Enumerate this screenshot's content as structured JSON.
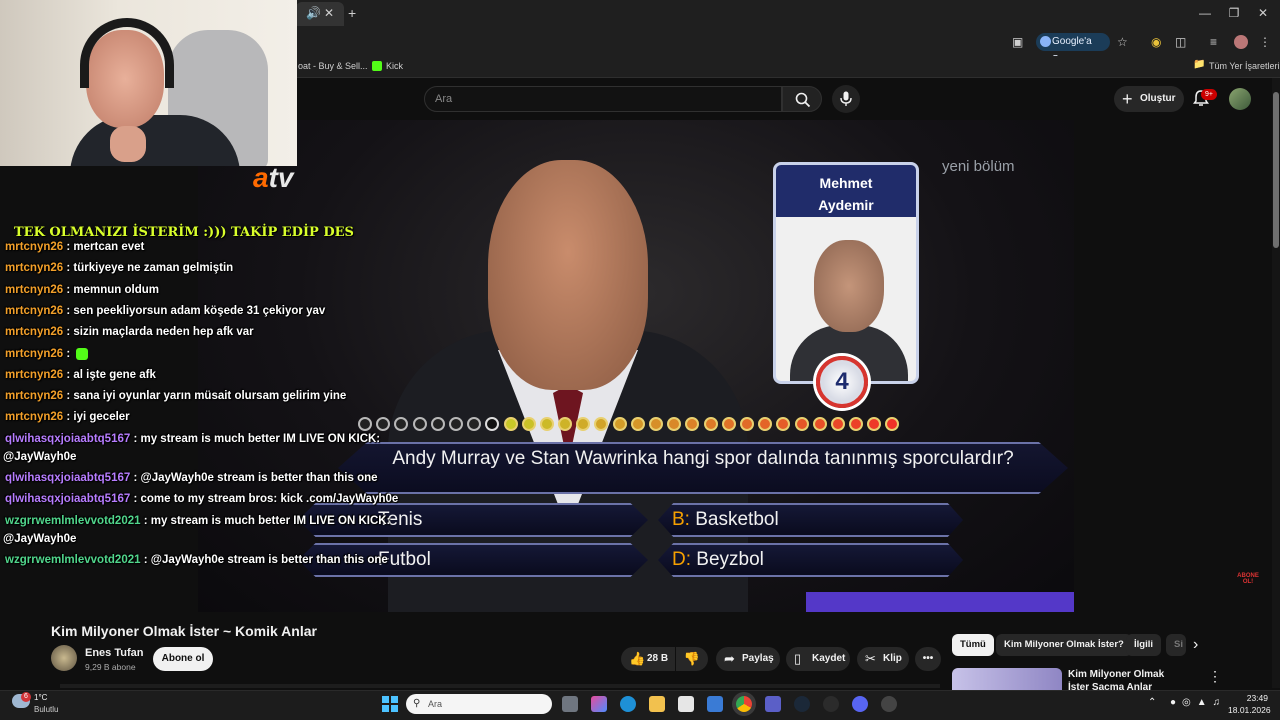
{
  "browser": {
    "tab_fragment": "",
    "google_button": "Google'a Sor",
    "bookmark_1": "oat - Buy & Sell...",
    "bookmark_2": "Kick",
    "all_bookmarks": "Tüm Yer İşaretleri"
  },
  "youtube": {
    "search_placeholder": "Ara",
    "create_label": "Oluştur",
    "notifications_badge": "9+"
  },
  "video_overlay": {
    "channel_logo": "atv",
    "corner_text": "yeni bölüm",
    "caller_name_line1": "Mehmet",
    "caller_name_line2": "Aydemir",
    "lifeline_number": "4",
    "question": "Andy Murray ve Stan Wawrinka hangi spor dalında tanınmış sporculardır?",
    "answers": [
      {
        "letter": "",
        "text": "Tenis"
      },
      {
        "letter": "B:",
        "text": "Basketbol"
      },
      {
        "letter": "",
        "text": "Futbol"
      },
      {
        "letter": "D:",
        "text": "Beyzbol"
      }
    ],
    "subscribe_badge": "ABONE OL!"
  },
  "chat": {
    "banner": "TEK OLMANIZI İSTERİM :))) TAKİP EDİP DES",
    "messages": [
      {
        "user": "mrtcnyn26",
        "text": ": mertcan evet"
      },
      {
        "user": "mrtcnyn26",
        "text": ": türkiyeye ne zaman gelmiştin"
      },
      {
        "user": "mrtcnyn26",
        "text": ": memnun oldum"
      },
      {
        "user": "mrtcnyn26",
        "text": ": sen peekliyorsun adam köşede 31 çekiyor yav"
      },
      {
        "user": "mrtcnyn26",
        "text": ": sizin maçlarda neden hep afk var"
      },
      {
        "user": "mrtcnyn26",
        "text": ":"
      },
      {
        "user": "mrtcnyn26",
        "text": ": al işte gene afk"
      },
      {
        "user": "mrtcnyn26",
        "text": ": sana iyi oyunlar yarın müsait olursam gelirim yine"
      },
      {
        "user": "mrtcnyn26",
        "text": ": iyi geceler"
      },
      {
        "user": "qlwihasqxjoiaabtq5167",
        "text": ": my stream is much better IM LIVE ON KICK:",
        "cont": "@JayWayh0e"
      },
      {
        "user": "qlwihasqxjoiaabtq5167",
        "text": ": @JayWayh0e stream is better than this one"
      },
      {
        "user": "qlwihasqxjoiaabtq5167",
        "text": ": come to my stream bros: kick .com/JayWayh0e"
      },
      {
        "user": "wzgrrwemlmlevvotd2021",
        "text": ": my stream is much better IM LIVE ON KICK:",
        "cont": "@JayWayh0e"
      },
      {
        "user": "wzgrrwemlmlevvotd2021",
        "text": ": @JayWayh0e stream is better than this one"
      }
    ]
  },
  "video_info": {
    "title": "Kim Milyoner Olmak İster ~ Komik Anlar",
    "channel": "Enes Tufan",
    "subscribers": "9,29 B abone",
    "subscribe": "Abone ol",
    "likes": "28 B",
    "share": "Paylaş",
    "save": "Kaydet",
    "clip": "Klip",
    "more": "•••"
  },
  "recommendations": {
    "chips": [
      "Tümü",
      "Kim Milyoner Olmak İster?",
      "İlgili",
      "Si"
    ],
    "first_title": "Kim Milyoner Olmak İster Saçma Anlar"
  },
  "taskbar": {
    "weather_badge": "6",
    "temperature": "1°C",
    "weather": "Bulutlu",
    "search": "Ara",
    "time": "23:49",
    "date": "18.01.2026"
  },
  "colors": {
    "chat_user_orange": "#f3a02a",
    "chat_user_purple": "#b77dff",
    "chat_user_green": "#51d68c",
    "chat_banner": "#d9ff2b",
    "answer_letter": "#f6a000"
  }
}
